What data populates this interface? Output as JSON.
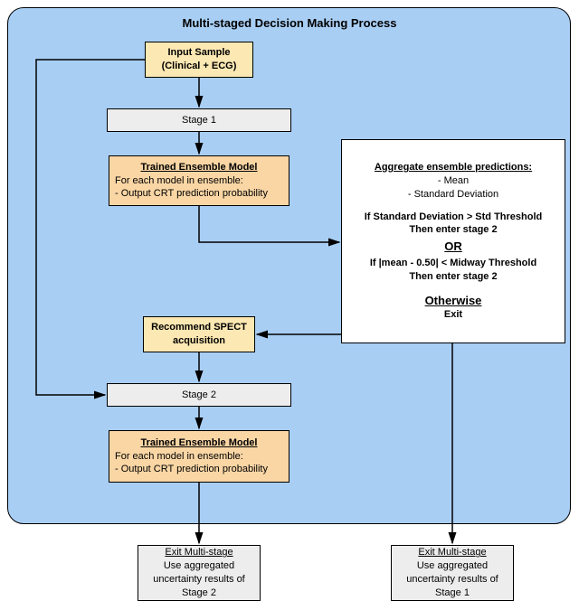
{
  "title": "Multi-staged Decision Making Process",
  "input": {
    "l1": "Input Sample",
    "l2": "(Clinical + ECG)"
  },
  "stage1": "Stage 1",
  "ens": {
    "t": "Trained Ensemble Model",
    "l1": "For each model in ensemble:",
    "l2": "- Output CRT prediction probability"
  },
  "spect": {
    "l1": "Recommend SPECT",
    "l2": "acquisition"
  },
  "stage2": "Stage 2",
  "decision": {
    "t": "Aggregate ensemble predictions:",
    "a1": "- Mean",
    "a2": "- Standard Deviation",
    "c1a": "If Standard Deviation > Std Threshold",
    "c1b": "Then enter stage 2",
    "or": "OR",
    "c2a": "If |mean - 0.50| < Midway Threshold",
    "c2b": "Then enter stage 2",
    "oth": "Otherwise",
    "ex": "Exit"
  },
  "exit2": {
    "t": "Exit Multi-stage",
    "l1": "Use aggregated",
    "l2": "uncertainty results of",
    "l3": "Stage 2"
  },
  "exit1": {
    "t": "Exit Multi-stage",
    "l1": "Use aggregated",
    "l2": "uncertainty results of",
    "l3": "Stage 1"
  }
}
